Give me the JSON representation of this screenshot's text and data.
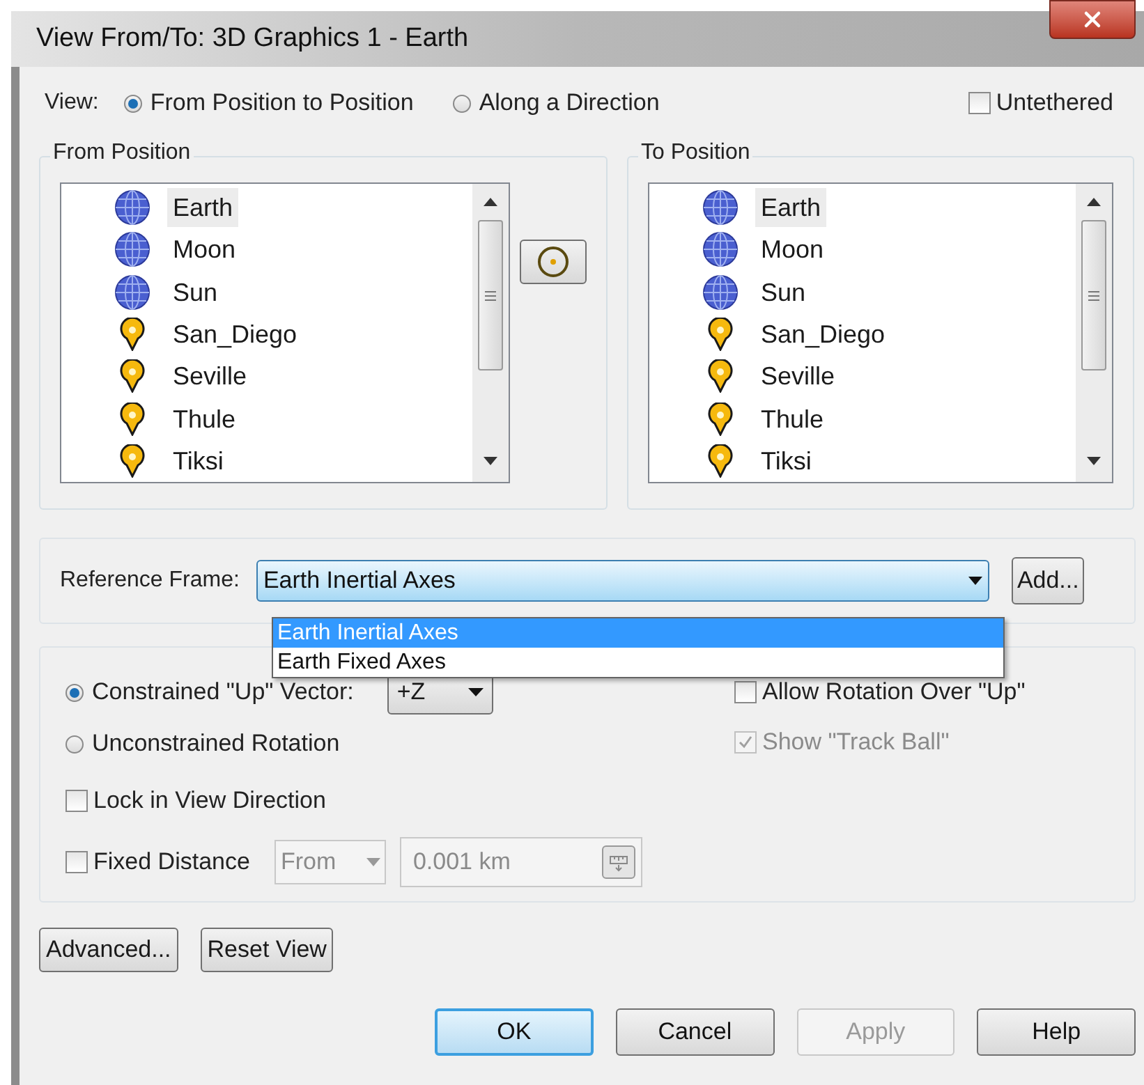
{
  "window": {
    "title": "View From/To: 3D Graphics 1 - Earth"
  },
  "view": {
    "label": "View:",
    "options": [
      {
        "label": "From Position to Position",
        "selected": true
      },
      {
        "label": "Along a Direction",
        "selected": false
      }
    ],
    "untethered": {
      "label": "Untethered",
      "checked": false
    }
  },
  "from_position": {
    "title": "From Position",
    "items": [
      {
        "name": "Earth",
        "kind": "globe",
        "selected": true
      },
      {
        "name": "Moon",
        "kind": "globe",
        "selected": false
      },
      {
        "name": "Sun",
        "kind": "globe",
        "selected": false
      },
      {
        "name": "San_Diego",
        "kind": "pin",
        "selected": false
      },
      {
        "name": "Seville",
        "kind": "pin",
        "selected": false
      },
      {
        "name": "Thule",
        "kind": "pin",
        "selected": false
      },
      {
        "name": "Tiksi",
        "kind": "pin",
        "selected": false
      }
    ]
  },
  "to_position": {
    "title": "To Position",
    "items": [
      {
        "name": "Earth",
        "kind": "globe",
        "selected": true
      },
      {
        "name": "Moon",
        "kind": "globe",
        "selected": false
      },
      {
        "name": "Sun",
        "kind": "globe",
        "selected": false
      },
      {
        "name": "San_Diego",
        "kind": "pin",
        "selected": false
      },
      {
        "name": "Seville",
        "kind": "pin",
        "selected": false
      },
      {
        "name": "Thule",
        "kind": "pin",
        "selected": false
      },
      {
        "name": "Tiksi",
        "kind": "pin",
        "selected": false
      }
    ]
  },
  "reference_frame": {
    "label": "Reference Frame:",
    "value": "Earth Inertial Axes",
    "expanded": true,
    "options": [
      {
        "label": "Earth Inertial Axes",
        "selected": true
      },
      {
        "label": "Earth Fixed Axes",
        "selected": false
      }
    ],
    "add_button": "Add..."
  },
  "orientation": {
    "modes": [
      {
        "label": "Constrained \"Up\" Vector:",
        "selected": true
      },
      {
        "label": "Unconstrained Rotation",
        "selected": false
      }
    ],
    "up_vector": "+Z",
    "allow_rotation": {
      "label": "Allow Rotation Over \"Up\"",
      "checked": false,
      "disabled": false
    },
    "show_track_ball": {
      "label": "Show \"Track Ball\"",
      "checked": true,
      "disabled": true
    },
    "lock_view_direction": {
      "label": "Lock in View Direction",
      "checked": false
    },
    "fixed_distance": {
      "label": "Fixed Distance",
      "checked": false,
      "from": "From",
      "distance": "0.001 km"
    }
  },
  "action_buttons": [
    "Advanced...",
    "Reset View"
  ],
  "footer_buttons": [
    {
      "label": "OK",
      "kind": "default"
    },
    {
      "label": "Cancel",
      "kind": "normal"
    },
    {
      "label": "Apply",
      "kind": "disabled"
    },
    {
      "label": "Help",
      "kind": "normal"
    }
  ]
}
